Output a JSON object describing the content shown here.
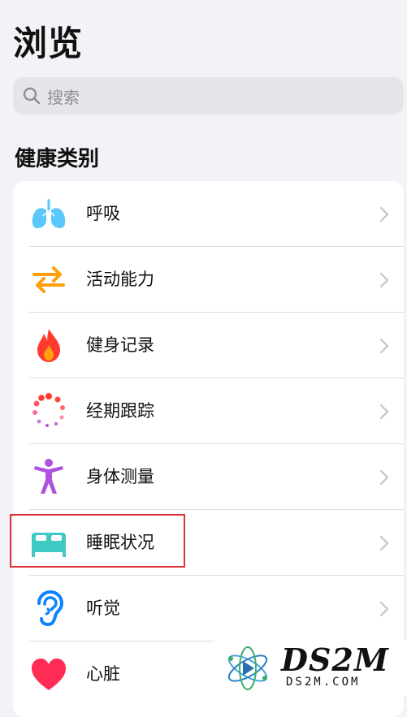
{
  "page": {
    "title": "浏览"
  },
  "search": {
    "placeholder": "搜索",
    "icon": "search-icon"
  },
  "section": {
    "title": "健康类别"
  },
  "categories": [
    {
      "label": "呼吸",
      "icon": "lungs-icon",
      "color": "#5ac8fa"
    },
    {
      "label": "活动能力",
      "icon": "arrows-icon",
      "color": "#ff9f0a"
    },
    {
      "label": "健身记录",
      "icon": "flame-icon",
      "color": "#ff3b30"
    },
    {
      "label": "经期跟踪",
      "icon": "cycle-dots-icon",
      "color": "#ff6b6b"
    },
    {
      "label": "身体测量",
      "icon": "figure-icon",
      "color": "#af52de"
    },
    {
      "label": "睡眠状况",
      "icon": "bed-icon",
      "color": "#40c8c4"
    },
    {
      "label": "听觉",
      "icon": "ear-icon",
      "color": "#0a84ff"
    },
    {
      "label": "心脏",
      "icon": "heart-icon",
      "color": "#ff2d55"
    }
  ],
  "highlight": {
    "target": "睡眠状况",
    "color": "#e0333b"
  },
  "watermark": {
    "brand": "DS2M",
    "url": "DS2M.COM"
  }
}
